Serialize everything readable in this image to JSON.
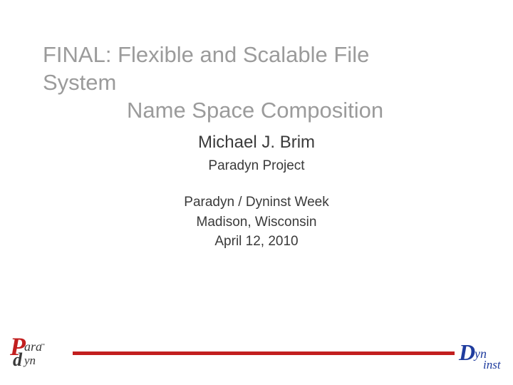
{
  "title": {
    "line1": "FINAL: Flexible and Scalable File System",
    "line2": "Name Space Composition"
  },
  "author": {
    "name": "Michael J. Brim",
    "affiliation": "Paradyn Project"
  },
  "event": {
    "name": "Paradyn / Dyninst Week",
    "location": "Madison, Wisconsin",
    "date": "April 12, 2010"
  },
  "logos": {
    "left": {
      "p": "P",
      "ara": "ara",
      "d": "d",
      "yn": "yn",
      "tm": "™"
    },
    "right": {
      "d": "D",
      "yn": "yn",
      "inst": "inst"
    }
  }
}
